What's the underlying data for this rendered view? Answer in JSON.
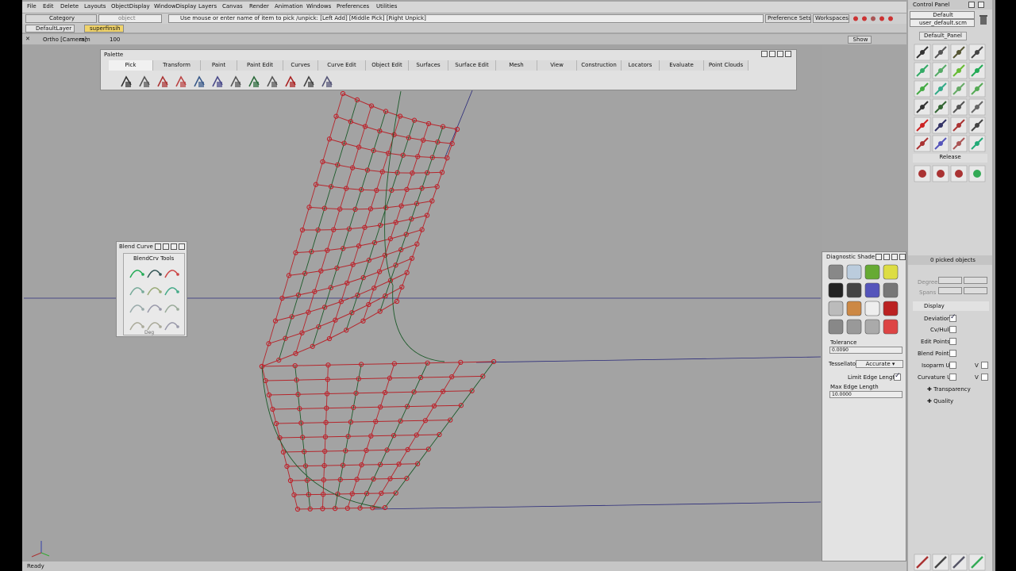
{
  "menu": [
    "File",
    "Edit",
    "Delete",
    "Layouts",
    "ObjectDisplay",
    "WindowDisplay",
    "Layers",
    "Canvas",
    "Render",
    "Animation",
    "Windows",
    "Preferences",
    "Utilities"
  ],
  "toolbar": {
    "category_label": "Category",
    "object_label": "object",
    "prompt": "Use mouse or enter name of item to pick /unpick: [Left Add] [Middle Pick] [Right Unpick]",
    "preference_sets": "Preference Sets",
    "workspaces": "Workspaces",
    "default_layer": "DefaultLayer",
    "layer2": "superfinsih",
    "camera": "Ortho [Camera]",
    "units": "mm",
    "zoom": "100",
    "show": "Show"
  },
  "palette": {
    "title": "Palette",
    "tabs": [
      "Pick",
      "Transform",
      "Paint",
      "Paint Edit",
      "Curves",
      "Curve Edit",
      "Object Edit",
      "Surfaces",
      "Surface Edit",
      "Mesh",
      "View",
      "Construction",
      "Locators",
      "Evaluate",
      "Point Clouds"
    ],
    "active_tab": "Pick"
  },
  "blend_curve": {
    "title": "Blend Curve",
    "tools_label": "BlendCrv Tools",
    "deg_label": "Deg"
  },
  "diagnostic": {
    "title": "Diagnostic Shade",
    "tolerance_label": "Tolerance",
    "tolerance_value": "0.0090",
    "tessellator_label": "Tessellator",
    "tessellator_value": "Accurate",
    "limit_edge_label": "Limit Edge Length",
    "max_edge_label": "Max Edge Length",
    "max_edge_value": "10.0000"
  },
  "control_panel": {
    "title": "Control Panel",
    "preset": "Default",
    "user_file": "user_default.scm",
    "panel_name": "Default_Panel",
    "release": "Release",
    "picked": "0 picked objects",
    "degree": "Degree",
    "spans": "Spans",
    "display": "Display",
    "deviation": "Deviation",
    "cv_hull": "Cv/Hull",
    "edit_points": "Edit Points",
    "blend_points": "Blend Points",
    "isoparm": "Isoparm U",
    "curvature": "Curvature U",
    "v": "V",
    "transparency": "Transparency",
    "quality": "Quality"
  },
  "status": "Ready",
  "colors": {
    "curve": "#b5262c",
    "cv": "#c0202a",
    "hull": "#1d5a2a",
    "axis": "#2a2a7a"
  }
}
